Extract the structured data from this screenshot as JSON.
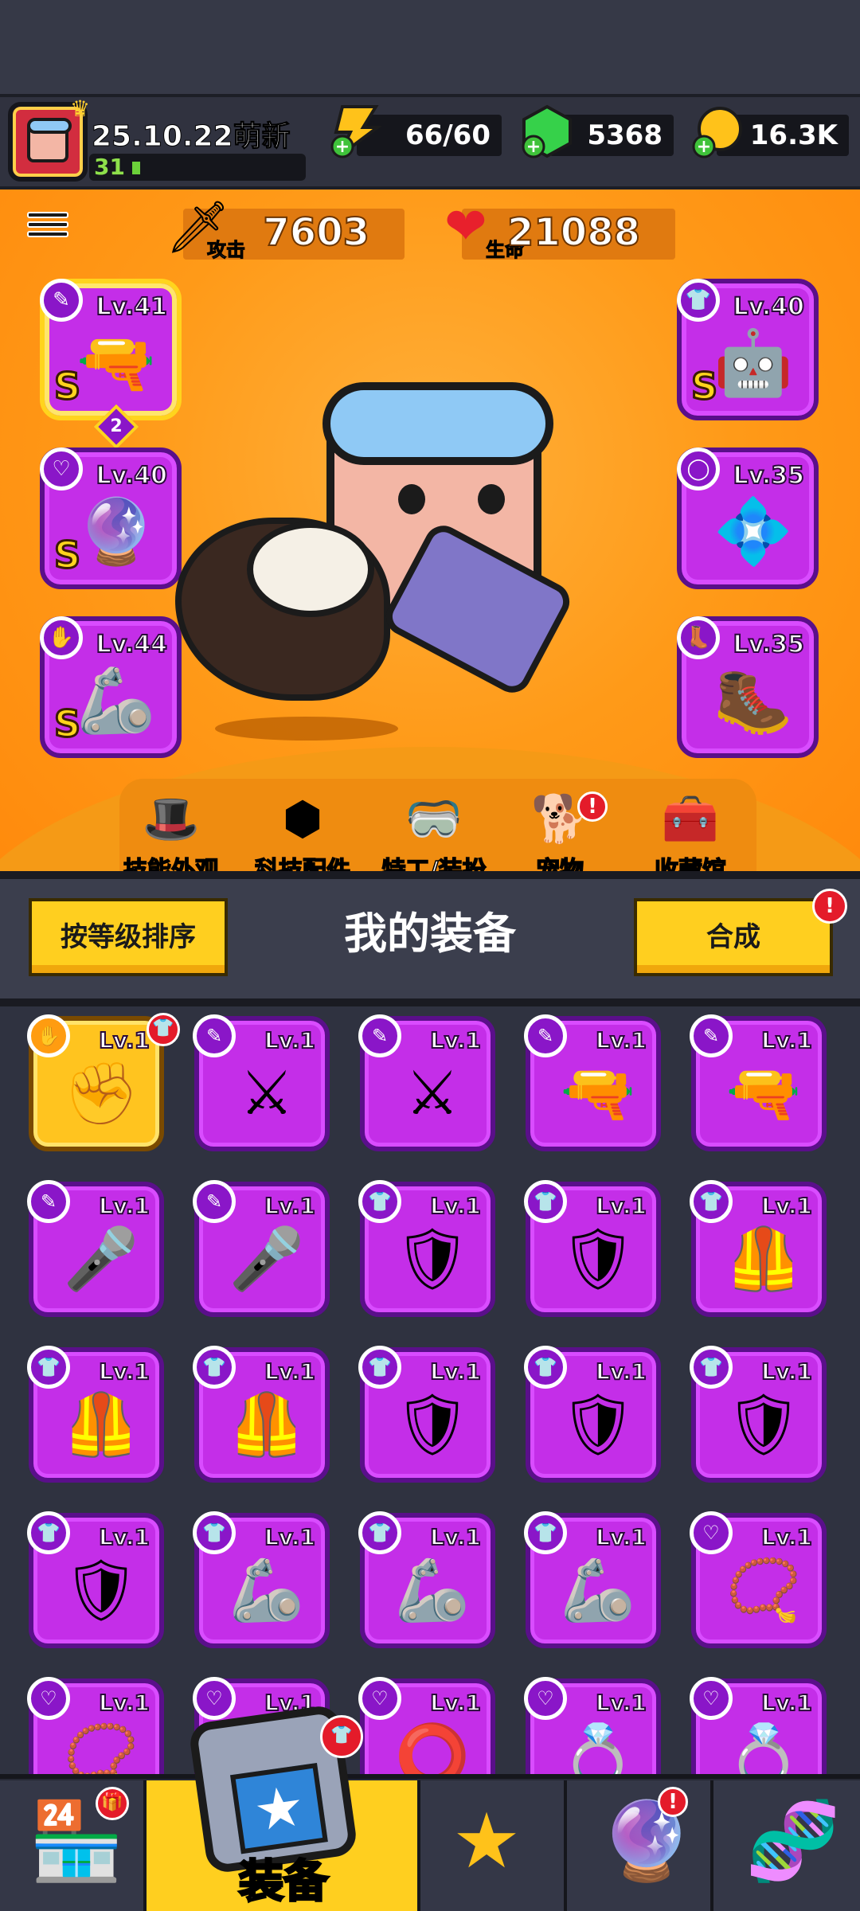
{
  "player": {
    "name": "25.10.22萌新",
    "level": "31"
  },
  "resources": {
    "energy": "66/60",
    "gems": "5368",
    "coins": "16.3K"
  },
  "stats": {
    "attack_value": "7603",
    "attack_label": "攻击",
    "hp_value": "21088",
    "hp_label": "生命"
  },
  "equipped": [
    {
      "slot": "weapon",
      "level": "Lv.41",
      "rank": "S",
      "icon": "weapon-icon",
      "art": "raygun",
      "stars": "2"
    },
    {
      "slot": "armor",
      "level": "Lv.40",
      "rank": "S",
      "icon": "armor-icon",
      "art": "mech-armor"
    },
    {
      "slot": "necklace",
      "level": "Lv.40",
      "rank": "S",
      "icon": "necklace-icon",
      "art": "amulet"
    },
    {
      "slot": "belt",
      "level": "Lv.35",
      "rank": "",
      "icon": "belt-icon",
      "art": "belt"
    },
    {
      "slot": "gloves",
      "level": "Lv.44",
      "rank": "S",
      "icon": "glove-icon",
      "art": "gauntlet"
    },
    {
      "slot": "boots",
      "level": "Lv.35",
      "rank": "",
      "icon": "boot-icon",
      "art": "boots"
    }
  ],
  "features": [
    {
      "label": "技能外观",
      "icon": "skill-skin-icon"
    },
    {
      "label": "科技配件",
      "icon": "tech-part-icon"
    },
    {
      "label": "特工/装扮",
      "icon": "agent-icon"
    },
    {
      "label": "宠物",
      "icon": "pet-icon"
    },
    {
      "label": "收藏馆",
      "icon": "collection-icon"
    }
  ],
  "equipment_panel": {
    "sort_label": "按等级排序",
    "title": "我的装备",
    "merge_label": "合成"
  },
  "inventory": [
    {
      "level": "Lv.1",
      "type": "glove",
      "art": "✊",
      "gold": true
    },
    {
      "level": "Lv.1",
      "type": "weapon",
      "art": "⚔"
    },
    {
      "level": "Lv.1",
      "type": "weapon",
      "art": "⚔"
    },
    {
      "level": "Lv.1",
      "type": "weapon",
      "art": "🔫"
    },
    {
      "level": "Lv.1",
      "type": "weapon",
      "art": "🔫"
    },
    {
      "level": "Lv.1",
      "type": "weapon",
      "art": "🎤"
    },
    {
      "level": "Lv.1",
      "type": "weapon",
      "art": "🎤"
    },
    {
      "level": "Lv.1",
      "type": "armor",
      "art": "🛡"
    },
    {
      "level": "Lv.1",
      "type": "armor",
      "art": "🛡"
    },
    {
      "level": "Lv.1",
      "type": "armor",
      "art": "🦺"
    },
    {
      "level": "Lv.1",
      "type": "armor",
      "art": "🦺"
    },
    {
      "level": "Lv.1",
      "type": "armor",
      "art": "🦺"
    },
    {
      "level": "Lv.1",
      "type": "armor",
      "art": "🛡"
    },
    {
      "level": "Lv.1",
      "type": "armor",
      "art": "🛡"
    },
    {
      "level": "Lv.1",
      "type": "armor",
      "art": "🛡"
    },
    {
      "level": "Lv.1",
      "type": "armor",
      "art": "🛡"
    },
    {
      "level": "Lv.1",
      "type": "armor",
      "art": "🦾"
    },
    {
      "level": "Lv.1",
      "type": "armor",
      "art": "🦾"
    },
    {
      "level": "Lv.1",
      "type": "armor",
      "art": "🦾"
    },
    {
      "level": "Lv.1",
      "type": "necklace",
      "art": "📿"
    },
    {
      "level": "Lv.1",
      "type": "necklace",
      "art": "📿"
    },
    {
      "level": "Lv.1",
      "type": "necklace",
      "art": "📿"
    },
    {
      "level": "Lv.1",
      "type": "necklace",
      "art": "⭕"
    },
    {
      "level": "Lv.1",
      "type": "necklace",
      "art": "💍"
    },
    {
      "level": "Lv.1",
      "type": "necklace",
      "art": "💍"
    }
  ],
  "nav": {
    "active_label": "装备"
  },
  "colors": {
    "hero_bg": "#ff9a18",
    "slot_purple": "#c42ee8",
    "accent_yellow": "#ffcf1f",
    "alert_red": "#e41b2a"
  }
}
